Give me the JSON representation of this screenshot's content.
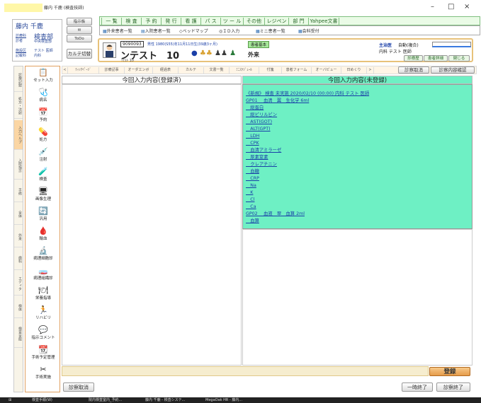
{
  "window": {
    "title": "藤内 千鹿 (検査技師)",
    "controls": [
      "–",
      "□",
      "×"
    ]
  },
  "user": {
    "name": "藤内 千鹿",
    "dept": "検査部",
    "row1_left": "診療科",
    "row1_sub": "診者",
    "row1_right": "中央検査部",
    "row2_left": "施設区",
    "row2_sub": "記載科",
    "row2_right": "テスト 医師",
    "row2_extra": "内科"
  },
  "side_buttons": {
    "indicate": "指示板",
    "mail": "✉",
    "todo": "ToDo",
    "card": "カルテ切替"
  },
  "menu": [
    "一 覧",
    "検 査",
    "予 約",
    "発 行",
    "看 護",
    "パ ス",
    "ツ ー ル",
    "その他",
    "レジペン",
    "部 門",
    "Yahpee文書"
  ],
  "toolbar2": [
    "外来患者一覧",
    "入院患者一覧",
    "ベッドマップ",
    "ＩＤ入力",
    "ミニ患者一覧",
    "会科受付"
  ],
  "patient": {
    "id": "9090093",
    "sex_age": "男性 1980(S55)年11月11日生(39歳3ヶ月)",
    "name": "ンテスト　10",
    "kana": "ｿﾃｽﾄ 10",
    "badge": "患者基本",
    "visit": "外来",
    "doctor_label": "主治医",
    "doctor": "自動(複合)",
    "dept_doctor": "内科 テスト 医師",
    "btn1": "診療歴",
    "btn2": "患者詳細",
    "btn3": "閉じる"
  },
  "left_tabs": [
    "診療記録",
    "処方・注射",
    "入力ヘルプ",
    "入院指示",
    "手術",
    "全体",
    "外来",
    "歯科",
    "エディタ",
    "検体",
    "検査全般"
  ],
  "icons": [
    {
      "name": "セット入力",
      "glyph": "📋"
    },
    {
      "name": "病名",
      "glyph": "🩺"
    },
    {
      "name": "予約",
      "glyph": "📅"
    },
    {
      "name": "処方",
      "glyph": "💊"
    },
    {
      "name": "注射",
      "glyph": "💉"
    },
    {
      "name": "検査",
      "glyph": "🧪"
    },
    {
      "name": "画像生理",
      "glyph": "🖥"
    },
    {
      "name": "汎用",
      "glyph": "🔄"
    },
    {
      "name": "輸血",
      "glyph": "🩸"
    },
    {
      "name": "病理細胞診",
      "glyph": "🔬"
    },
    {
      "name": "病理組織診",
      "glyph": "🧫"
    },
    {
      "name": "栄養指導",
      "glyph": "🍽"
    },
    {
      "name": "リハビリ",
      "glyph": "🏃"
    },
    {
      "name": "指示コメント",
      "glyph": "💬"
    },
    {
      "name": "手術予定管理",
      "glyph": "📆"
    },
    {
      "name": "手術実施",
      "glyph": "✂"
    }
  ],
  "tabs": [
    "<",
    "ﾃｨｯｸﾍﾟｰｼﾞ",
    "診療記事",
    "オーダエンボ",
    "経過表",
    "カルテ",
    "文書一覧",
    "ﾐﾆｽｹｼﾞｭｰﾙ",
    "付箋",
    "患者フォーム",
    "オーバビュー",
    "日めくり",
    ">"
  ],
  "tab_buttons": {
    "cancel": "診察取消",
    "confirm": "診察内容確認"
  },
  "left_panel_title": "今回入力内容(登録済)",
  "right_panel_title": "今回入力内容(未登録)",
  "right_panel_lines": [
    "《新規》 検査  未実施  2020/02/10 (00:00) 内科  テスト 医師",
    "GP01　 血清　翼　生化学 6ml",
    "　総蛋白",
    "　総ビリルビン",
    "　AST(GOT)",
    "　ALT(GPT)",
    "　LDH",
    "　CPK",
    "　血清アミラーゼ",
    "　尿素窒素",
    "　クレアチニン",
    "　血糖",
    "　CRP",
    "　Na",
    "　K",
    "　Cl",
    "　Ca",
    "GP02　 血液　翠　血算 2ml",
    "　血算"
  ],
  "register_button": "登録",
  "bottom": {
    "cancel": "診察取消",
    "pause": "一時終了",
    "finish": "診察終了"
  },
  "taskbar": [
    "検査手順(W)",
    "院内検査室内_予約...",
    "藤内 千鹿 - 検査システ...",
    "MegaOak HR - 藤内..."
  ],
  "colors": {
    "green_panel": "#6ef0c4",
    "accent": "#e0a060",
    "link": "#1a3fa8"
  }
}
